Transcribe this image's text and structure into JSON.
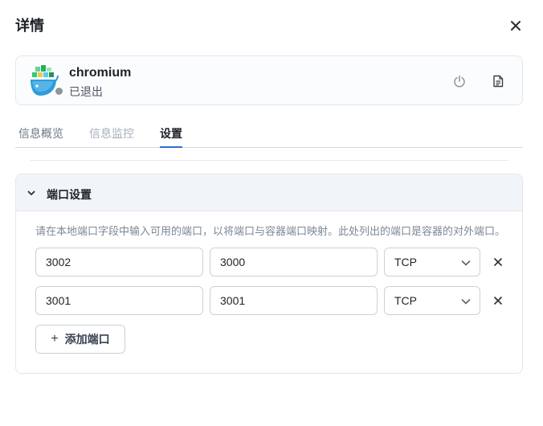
{
  "panel": {
    "title": "详情",
    "close_icon": "close-icon"
  },
  "app": {
    "name": "chromium",
    "status": "已退出",
    "status_color": "#8e949c",
    "icon": "docker-whale-icon"
  },
  "actions": [
    {
      "icon": "power-icon"
    },
    {
      "icon": "document-log-icon"
    }
  ],
  "tabs": [
    {
      "label": "信息概览",
      "active": false
    },
    {
      "label": "信息监控",
      "active": false
    },
    {
      "label": "设置",
      "active": true
    }
  ],
  "accent_color": "#2f6fd0",
  "port_section": {
    "title": "端口设置",
    "expanded": true,
    "hint": "请在本地端口字段中输入可用的端口，以将端口与容器端口映射。此处列出的端口是容器的对外端口。",
    "rows": [
      {
        "local_port": "3002",
        "container_port": "3000",
        "protocol": "TCP"
      },
      {
        "local_port": "3001",
        "container_port": "3001",
        "protocol": "TCP"
      }
    ],
    "add_label": "添加端口"
  }
}
